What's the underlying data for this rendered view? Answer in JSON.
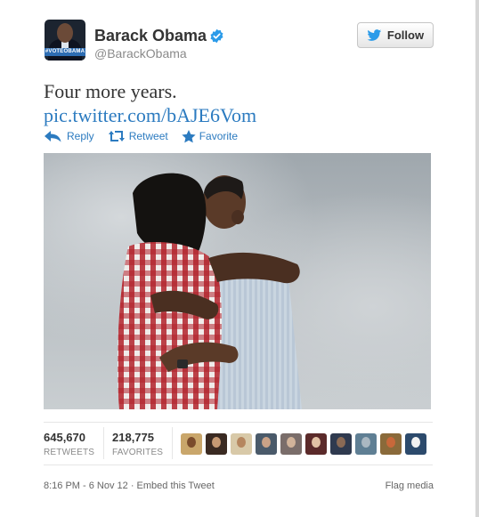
{
  "header": {
    "display_name": "Barack Obama",
    "handle": "@BarackObama",
    "avatar_banner": "#VOTEOBAMA",
    "follow_label": "Follow",
    "verified_icon": "verified-badge-icon"
  },
  "tweet": {
    "text": "Four more years.",
    "link": "pic.twitter.com/bAJE6Vom"
  },
  "actions": {
    "reply": "Reply",
    "retweet": "Retweet",
    "favorite": "Favorite"
  },
  "stats": {
    "retweets_count": "645,670",
    "retweets_label": "RETWEETS",
    "favorites_count": "218,775",
    "favorites_label": "FAVORITES"
  },
  "favoriters": [
    {
      "name": "favoriter-avatar-1",
      "bg": "#c9a66b",
      "head": "#7a4b2c"
    },
    {
      "name": "favoriter-avatar-2",
      "bg": "#3a2a22",
      "head": "#c79a74"
    },
    {
      "name": "favoriter-avatar-3",
      "bg": "#d8c9a8",
      "head": "#b5865f"
    },
    {
      "name": "favoriter-avatar-4",
      "bg": "#4a5a6a",
      "head": "#caa287"
    },
    {
      "name": "favoriter-avatar-5",
      "bg": "#7a6d6a",
      "head": "#d1b39a"
    },
    {
      "name": "favoriter-avatar-6",
      "bg": "#5b2a2a",
      "head": "#e3c2a5"
    },
    {
      "name": "favoriter-avatar-7",
      "bg": "#2f3a4f",
      "head": "#8a6a55"
    },
    {
      "name": "favoriter-avatar-8",
      "bg": "#5f7f94",
      "head": "#aab8c2"
    },
    {
      "name": "favoriter-avatar-9",
      "bg": "#8a6a3a",
      "head": "#c8683a"
    },
    {
      "name": "favoriter-avatar-10",
      "bg": "#2c4a6c",
      "head": "#f2f2f2"
    }
  ],
  "footer": {
    "timestamp": "8:16 PM - 6 Nov 12 · Embed this Tweet",
    "flag_media": "Flag media"
  },
  "colors": {
    "link": "#2c7bc0",
    "text": "#333333",
    "muted": "#8a8a8a",
    "verified": "#2b9be9"
  }
}
